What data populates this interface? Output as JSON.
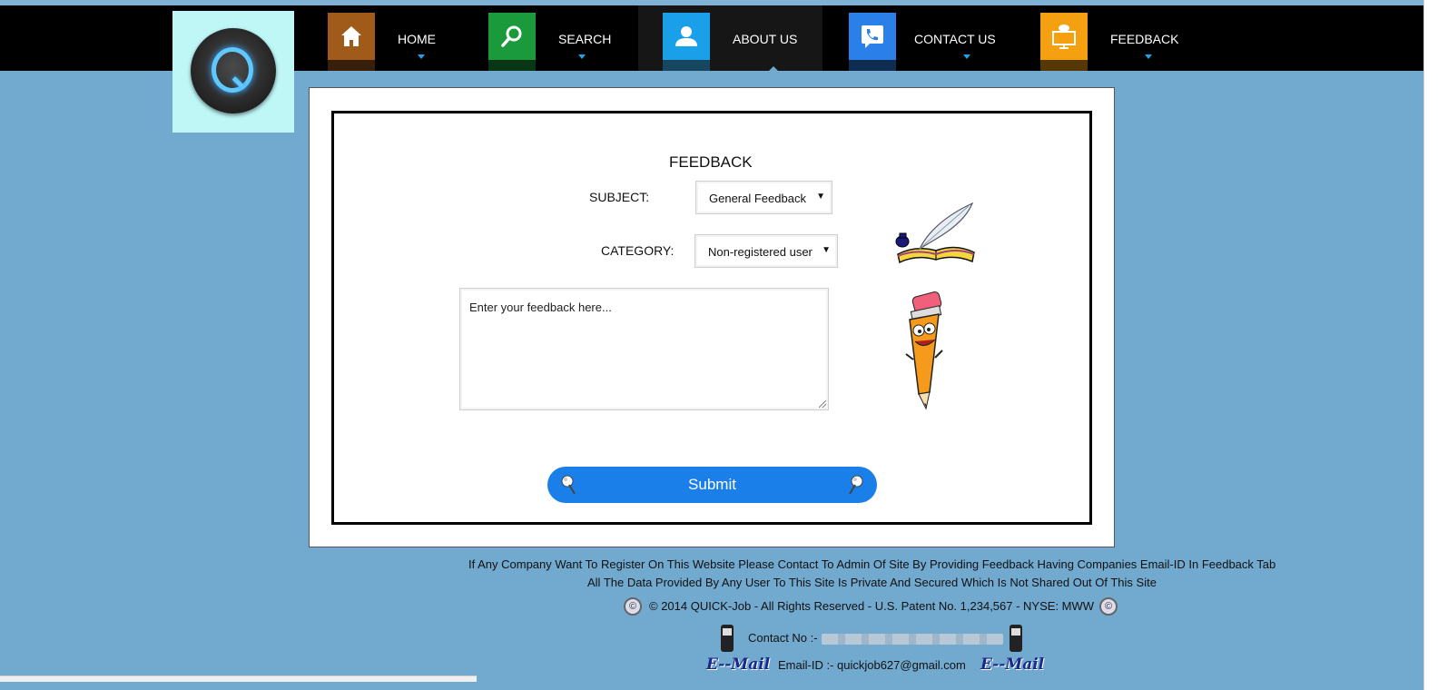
{
  "nav": {
    "items": [
      {
        "label": "HOME",
        "icon": "home-icon",
        "color": "#a05a1a"
      },
      {
        "label": "SEARCH",
        "icon": "search-icon",
        "color": "#1a9a3a"
      },
      {
        "label": "ABOUT US",
        "icon": "user-icon",
        "color": "#1aa0e8"
      },
      {
        "label": "CONTACT US",
        "icon": "phone-icon",
        "color": "#2a80e8"
      },
      {
        "label": "FEEDBACK",
        "icon": "monitor-chat-icon",
        "color": "#f5a010"
      }
    ],
    "active": "ABOUT US"
  },
  "form": {
    "title": "FEEDBACK",
    "subject_label": "SUBJECT:",
    "subject_value": "General Feedback",
    "category_label": "CATEGORY:",
    "category_value": "Non-registered user",
    "feedback_placeholder": "Enter your feedback here...",
    "submit_label": "Submit"
  },
  "footer": {
    "line1": "If Any Company Want To Register On This Website Please Contact To Admin Of Site By Providing Feedback Having Companies Email-ID In Feedback Tab",
    "line2": "All The Data Provided By Any User To This Site Is Private And Secured Which Is Not Shared Out Of This Site",
    "copyright": "© 2014 QUICK-Job - All Rights Reserved - U.S. Patent No. 1,234,567 - NYSE: MWW",
    "contact_label": "Contact No :-",
    "email_label": "Email-ID :- quickjob627@gmail.com",
    "email_logo": "E--Mail"
  },
  "colors": {
    "background": "#72a9cf",
    "navbar": "#000000",
    "submit": "#1a7fe8",
    "logo_bg": "#bff7f7"
  }
}
